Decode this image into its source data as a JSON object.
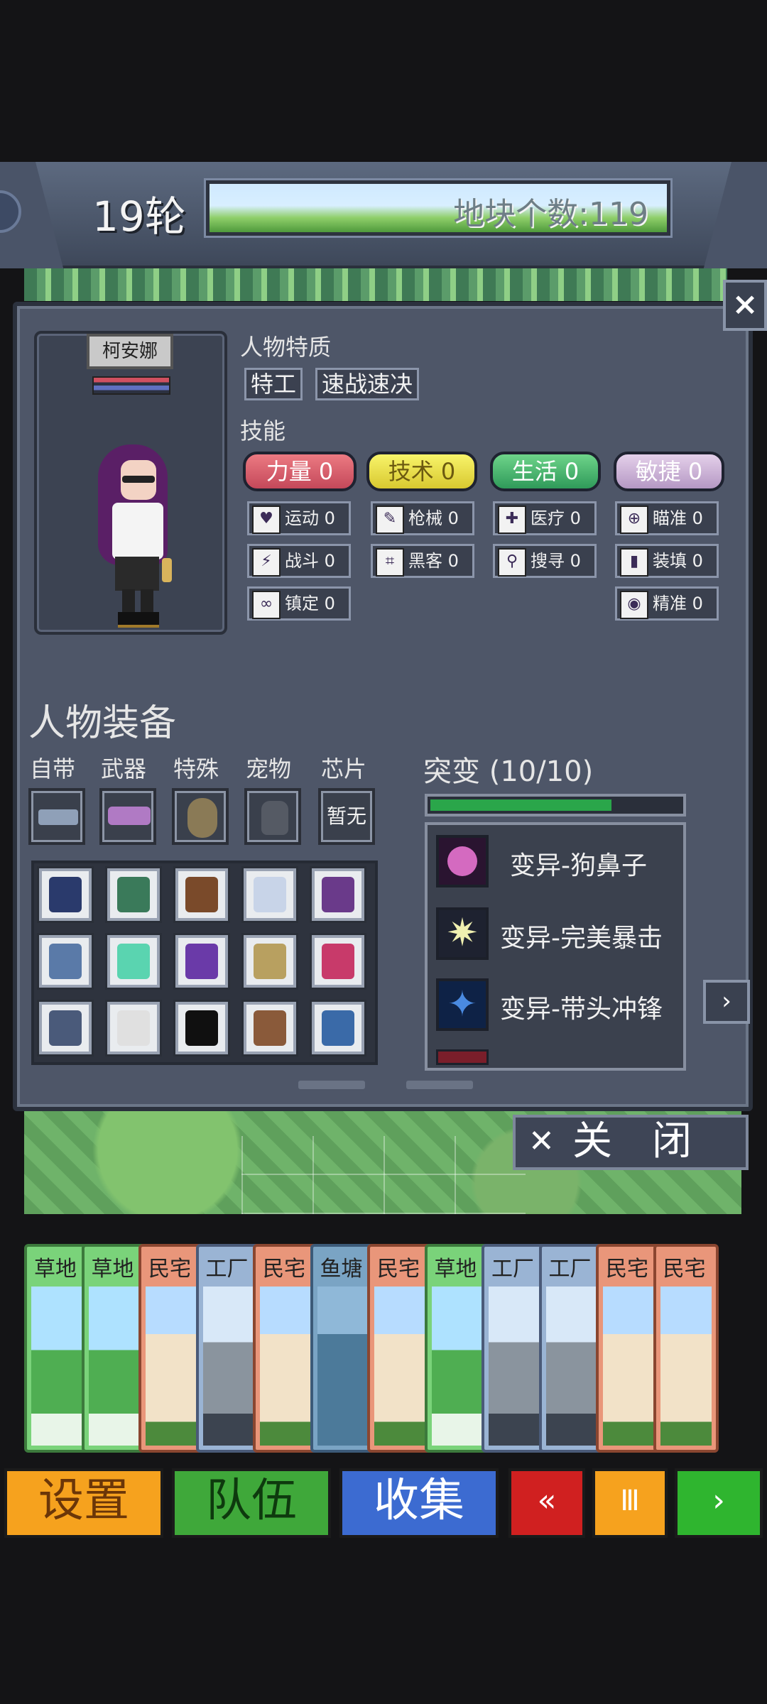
{
  "hud": {
    "round": "19轮",
    "tile_count": "地块个数:119"
  },
  "panel": {
    "close_icon": "×",
    "character_name": "柯安娜",
    "traits_heading": "人物特质",
    "traits": [
      "特工",
      "速战速决"
    ],
    "skills_heading": "技能",
    "stats": [
      {
        "label": "力量",
        "value": "0",
        "color": "#d85868"
      },
      {
        "label": "技术",
        "value": "0",
        "color": "#e8e04a"
      },
      {
        "label": "生活",
        "value": "0",
        "color": "#4cb672"
      },
      {
        "label": "敏捷",
        "value": "0",
        "color": "#cdb4d8"
      }
    ],
    "skills": {
      "strength": [
        {
          "label": "运动",
          "value": "0",
          "icon": "heart-icon"
        },
        {
          "label": "战斗",
          "value": "0",
          "icon": "lightning-icon"
        },
        {
          "label": "镇定",
          "value": "0",
          "icon": "glasses-icon"
        }
      ],
      "tech": [
        {
          "label": "枪械",
          "value": "0",
          "icon": "gun-icon"
        },
        {
          "label": "黑客",
          "value": "0",
          "icon": "circuit-icon"
        }
      ],
      "life": [
        {
          "label": "医疗",
          "value": "0",
          "icon": "medkit-icon"
        },
        {
          "label": "搜寻",
          "value": "0",
          "icon": "magnifier-icon"
        }
      ],
      "agility": [
        {
          "label": "瞄准",
          "value": "0",
          "icon": "crosshair-icon"
        },
        {
          "label": "装填",
          "value": "0",
          "icon": "magazine-icon"
        },
        {
          "label": "精准",
          "value": "0",
          "icon": "eye-icon"
        }
      ]
    },
    "equipment_heading": "人物装备",
    "slot_labels": [
      "自带",
      "武器",
      "特殊",
      "宠物",
      "芯片"
    ],
    "chip_slot_text": "暂无",
    "mutation_heading": "突变 (10/10)",
    "mutation_progress": 0.72,
    "mutations": [
      {
        "label": "变异-狗鼻子",
        "icon": "dog-nose-icon",
        "color": "#d46ac0"
      },
      {
        "label": "变异-完美暴击",
        "icon": "burst-icon",
        "color": "#f0f0b0"
      },
      {
        "label": "变异-带头冲锋",
        "icon": "winged-figure-icon",
        "color": "#4a8ae0"
      }
    ],
    "next_arrow": "›",
    "close_button": "关　闭"
  },
  "cards": [
    {
      "title": "草地",
      "type": "grass"
    },
    {
      "title": "草地",
      "type": "grass"
    },
    {
      "title": "民宅",
      "type": "home"
    },
    {
      "title": "工厂",
      "type": "factory"
    },
    {
      "title": "民宅",
      "type": "home"
    },
    {
      "title": "鱼塘",
      "type": "fish"
    },
    {
      "title": "民宅",
      "type": "home"
    },
    {
      "title": "草地",
      "type": "grass"
    },
    {
      "title": "工厂",
      "type": "factory"
    },
    {
      "title": "工厂",
      "type": "factory"
    },
    {
      "title": "民宅",
      "type": "home"
    },
    {
      "title": "民宅",
      "type": "home"
    }
  ],
  "bottom_bar": {
    "settings": "设置",
    "team": "队伍",
    "collect": "收集",
    "rewind": "«",
    "pause": "Ⅲ",
    "play": "›"
  }
}
